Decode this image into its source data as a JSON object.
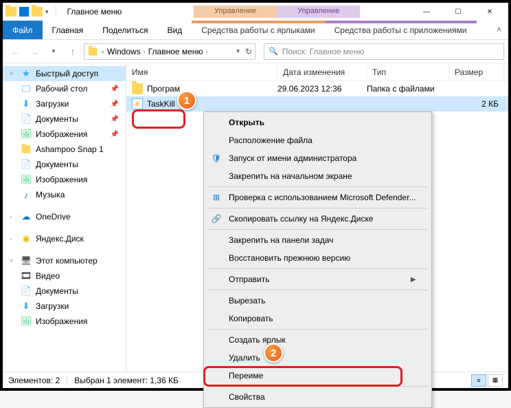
{
  "window": {
    "title": "Главное меню",
    "controls": {
      "min": "—",
      "max": "☐",
      "close": "✕"
    }
  },
  "ctx_headers": {
    "orange": "Управление",
    "purple": "Управление"
  },
  "tabs": {
    "file": "Файл",
    "home": "Главная",
    "share": "Поделиться",
    "view": "Вид",
    "ctx1": "Средства работы с ярлыками",
    "ctx2": "Средства работы с приложениями"
  },
  "breadcrumb": {
    "a": "Windows",
    "b": "Главное меню"
  },
  "search_placeholder": "Поиск: Главное меню",
  "sidebar": {
    "quick": "Быстрый доступ",
    "desktop": "Рабочий стол",
    "downloads": "Загрузки",
    "documents": "Документы",
    "pictures": "Изображения",
    "snap": "Ashampoo Snap 1",
    "documents2": "Документы",
    "pictures2": "Изображения",
    "music": "Музыка",
    "onedrive": "OneDrive",
    "yandex": "Яндекс.Диск",
    "thispc": "Этот компьютер",
    "video": "Видео",
    "documents3": "Документы",
    "downloads2": "Загрузки",
    "pictures3": "Изображения"
  },
  "columns": {
    "name": "Имя",
    "date": "Дата изменения",
    "type": "Тип",
    "size": "Размер"
  },
  "rows": [
    {
      "name": "Програм",
      "date": "29.06.2023 12:36",
      "type": "Папка с файлами",
      "size": ""
    },
    {
      "name": "TaskKill",
      "date": "",
      "type": "",
      "size": "2 КБ"
    }
  ],
  "statusbar": {
    "count": "Элементов: 2",
    "sel": "Выбран 1 элемент: 1,36 КБ"
  },
  "context_menu": {
    "open": "Открыть",
    "file_loc": "Расположение файла",
    "run_admin": "Запуск от имени администратора",
    "pin_start": "Закрепить на начальном экране",
    "defender": "Проверка с использованием Microsoft Defender...",
    "yandex_copy": "Скопировать ссылку на Яндекс.Диске",
    "pin_taskbar": "Закрепить на панели задач",
    "restore": "Восстановить прежнюю версию",
    "send_to": "Отправить",
    "cut": "Вырезать",
    "copy": "Копировать",
    "shortcut": "Создать ярлык",
    "delete": "Удалить",
    "rename": "Переиме",
    "props": "Свойства"
  }
}
